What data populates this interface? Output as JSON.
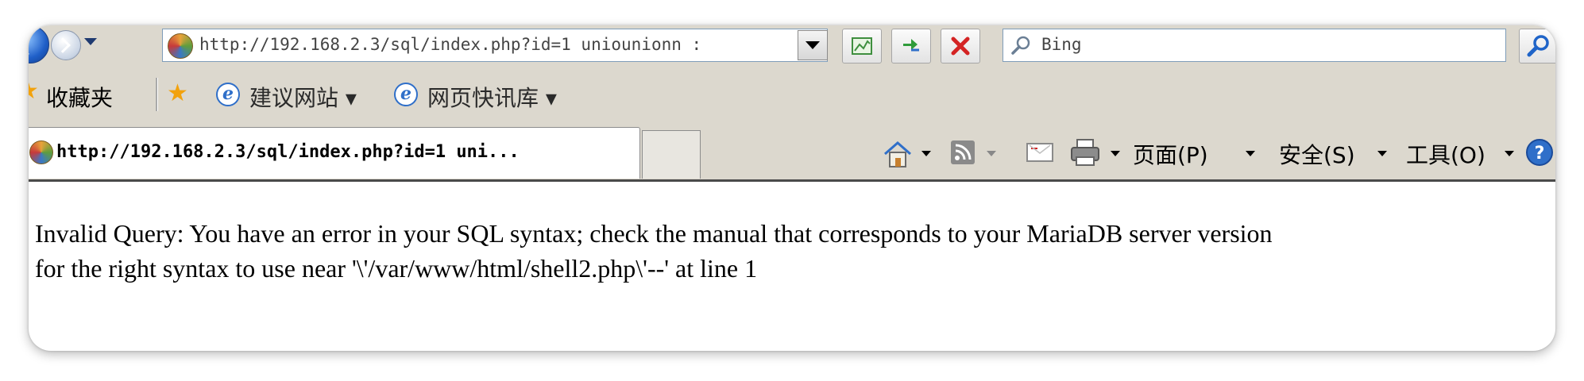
{
  "browser": {
    "address_url": "http://192.168.2.3/sql/index.php?id=1 uniounionn :",
    "search_placeholder": "Bing",
    "favorites_label": "收藏夹",
    "fav_links": [
      {
        "label": "建议网站 ▾"
      },
      {
        "label": "网页快讯库 ▾"
      }
    ],
    "tab_title": "http://192.168.2.3/sql/index.php?id=1 uni...",
    "commands": {
      "page": "页面(P)",
      "safety": "安全(S)",
      "tools": "工具(O)"
    }
  },
  "page": {
    "error_line1": "Invalid Query:  You have an error in your SQL syntax; check the manual that corresponds to your MariaDB server version",
    "error_line2": "for the right syntax to use near '\\'/var/www/html/shell2.php\\'--' at line 1"
  }
}
